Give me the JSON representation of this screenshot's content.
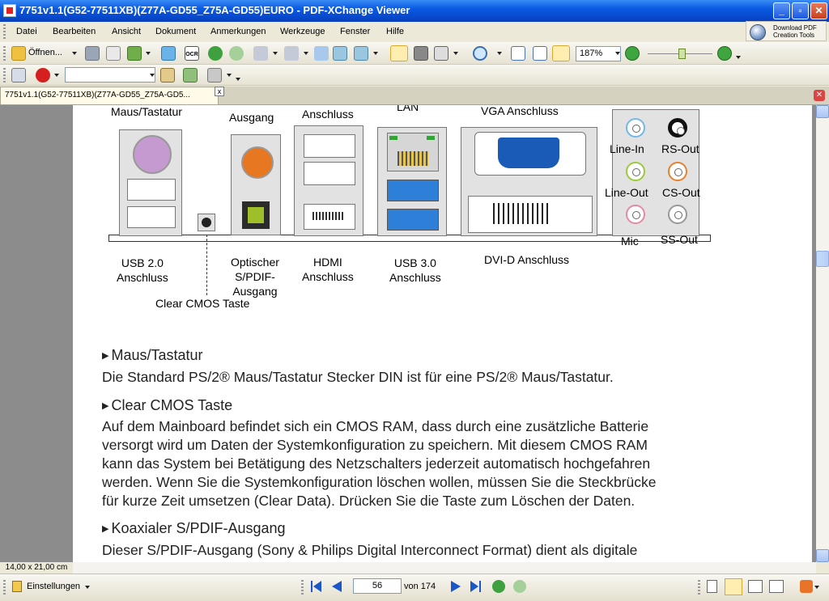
{
  "window": {
    "title": "7751v1.1(G52-77511XB)(Z77A-GD55_Z75A-GD55)EURO - PDF-XChange Viewer",
    "minimize": "_",
    "maximize": "▫",
    "close": "✕"
  },
  "menu": [
    "Datei",
    "Bearbeiten",
    "Ansicht",
    "Dokument",
    "Anmerkungen",
    "Werkzeuge",
    "Fenster",
    "Hilfe"
  ],
  "promo": {
    "line1": "Download PDF",
    "line2": "Creation Tools"
  },
  "toolbar": {
    "open_label": "Öffnen...",
    "ocr_label": "OCR",
    "zoom_value": "187%",
    "search_value": ""
  },
  "tab": {
    "label": "7751v1.1(G52-77511XB)(Z77A-GD55_Z75A-GD5...",
    "close": "x"
  },
  "status": {
    "page_size": "14,00 x 21,00 cm",
    "settings_label": "Einstellungen",
    "current_page": "56",
    "page_count_label": "von 174"
  },
  "figure": {
    "top_labels": {
      "mouse": "Maus/Tastatur",
      "spdif_out": "Ausgang",
      "anschluss": "Anschluss",
      "lan": "LAN",
      "vga": "VGA Anschluss"
    },
    "audio_labels": [
      "Line-In",
      "RS-Out",
      "Line-Out",
      "CS-Out",
      "Mic",
      "SS-Out"
    ],
    "bottom_labels": {
      "usb2": "USB 2.0\nAnschluss",
      "clear_cmos": "Clear CMOS Taste",
      "optical": "Optischer\nS/PDIF-\nAusgang",
      "hdmi": "HDMI\nAnschluss",
      "usb3": "USB 3.0\nAnschluss",
      "dvi": "DVI-D Anschluss"
    }
  },
  "sections": [
    {
      "heading": "Maus/Tastatur",
      "lines": [
        "Die Standard PS/2® Maus/Tastatur Stecker DIN ist für eine PS/2® Maus/Tastatur."
      ]
    },
    {
      "heading": "Clear CMOS Taste",
      "lines": [
        "Auf dem Mainboard befindet sich ein CMOS RAM, dass durch eine zusätzliche Batterie",
        "versorgt wird um Daten der Systemkonfiguration zu speichern.  Mit diesem CMOS RAM",
        "kann das System bei Betätigung des Netzschalters jederzeit automatisch hochgefahren",
        "werden. Wenn Sie die Systemkonfiguration löschen wollen, müssen Sie die Steckbrücke",
        "für kurze Zeit umsetzen (Clear Data).  Drücken Sie die Taste zum Löschen der Daten."
      ]
    },
    {
      "heading": "Koaxialer S/PDIF-Ausgang",
      "lines": [
        "Dieser S/PDIF-Ausgang (Sony & Philips Digital Interconnect Format) dient als digitale"
      ]
    }
  ],
  "colors": {
    "titlebar": "#0a5ae2",
    "vga_blue": "#1a5bb8",
    "usb3_blue": "#2d7fd8",
    "spdif_orange": "#e87722",
    "optical_green": "#9fbf2a"
  }
}
